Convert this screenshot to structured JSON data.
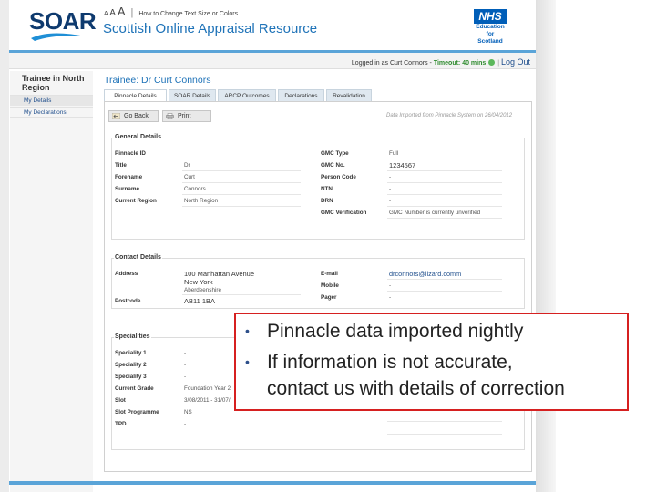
{
  "header": {
    "logo": "SOAR",
    "text_size_label": "How to Change Text Size or Colors",
    "text_size_glyphs": [
      "A",
      "A",
      "A"
    ],
    "site_title": "Scottish Online Appraisal Resource",
    "nhs_logo": "NHS",
    "nhs_sub": [
      "Education",
      "for",
      "Scotland"
    ]
  },
  "login": {
    "logged_in_as": "Logged in as",
    "user": "Curt Connors",
    "dash": " - ",
    "timeout_label": "Timeout: 40 mins",
    "logout": "Log Out"
  },
  "sidebar": {
    "title": "Trainee in North Region",
    "items": [
      {
        "label": "My Details"
      },
      {
        "label": "My Declarations"
      }
    ]
  },
  "main": {
    "trainee_title": "Trainee: Dr Curt Connors",
    "tabs": [
      {
        "label": "Pinnacle Details",
        "active": true
      },
      {
        "label": "SOAR Details",
        "active": false
      },
      {
        "label": "ARCP Outcomes",
        "active": false
      },
      {
        "label": "Declarations",
        "active": false
      },
      {
        "label": "Revalidation",
        "active": false
      }
    ],
    "buttons": {
      "back": "Go Back",
      "print": "Print"
    },
    "imported_note": "Data Imported from Pinnacle System on 26/04/2012"
  },
  "general": {
    "title": "General Details",
    "left": [
      {
        "label": "Pinnacle ID",
        "value": ""
      },
      {
        "label": "Title",
        "value": "Dr"
      },
      {
        "label": "Forename",
        "value": "Curt"
      },
      {
        "label": "Surname",
        "value": "Connors"
      },
      {
        "label": "Current Region",
        "value": "North Region"
      }
    ],
    "right": [
      {
        "label": "GMC Type",
        "value": "Full"
      },
      {
        "label": "GMC No.",
        "value": "1234567"
      },
      {
        "label": "Person Code",
        "value": "-"
      },
      {
        "label": "NTN",
        "value": "-"
      },
      {
        "label": "DRN",
        "value": "-"
      },
      {
        "label": "GMC Verification",
        "value": "GMC Number is currently unverified"
      }
    ]
  },
  "contact": {
    "title": "Contact Details",
    "address_label": "Address",
    "address_lines": [
      "100 Manhattan Avenue",
      "New York",
      "Aberdeenshire"
    ],
    "postcode_label": "Postcode",
    "postcode": "AB11 1BA",
    "right": [
      {
        "label": "E-mail",
        "value": "drconnors@lizard.comm"
      },
      {
        "label": "Mobile",
        "value": "-"
      },
      {
        "label": "Pager",
        "value": "-"
      }
    ]
  },
  "specialities": {
    "title": "Specialities",
    "rows": [
      {
        "label": "Speciality 1",
        "value": "-"
      },
      {
        "label": "Speciality 2",
        "value": "-"
      },
      {
        "label": "Speciality 3",
        "value": "-"
      },
      {
        "label": "Current Grade",
        "value": "Foundation Year 2"
      },
      {
        "label": "Slot",
        "value": "3/08/2011 - 31/07/"
      },
      {
        "label": "Slot Programme",
        "value": "NS"
      },
      {
        "label": "TPD",
        "value": "-"
      }
    ]
  },
  "callout": {
    "bullet": "•",
    "lines": [
      "Pinnacle data imported nightly",
      "If information is not accurate,",
      "contact us with details of correction"
    ]
  },
  "colors": {
    "brand_blue": "#1f73b8",
    "nhs_blue": "#005eb8",
    "callout_border": "#d62020",
    "timeout_green": "#2e8b2e"
  }
}
